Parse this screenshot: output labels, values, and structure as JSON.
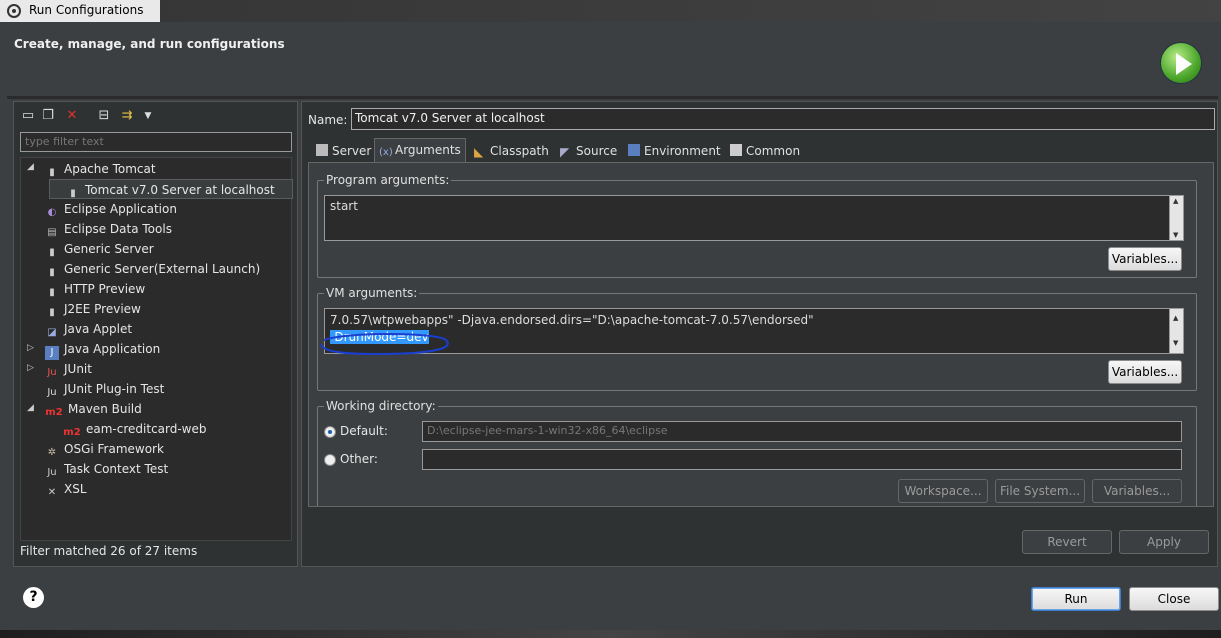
{
  "window": {
    "title": "Run Configurations"
  },
  "header": {
    "title": "Create, manage, and run configurations"
  },
  "left": {
    "filter_placeholder": "type filter text",
    "tree": [
      {
        "label": "Apache Tomcat",
        "icon": "tomcat-icon",
        "expanded": true
      },
      {
        "label": "Tomcat v7.0 Server at localhost",
        "icon": "server-icon",
        "selected": true
      },
      {
        "label": "Eclipse Application",
        "icon": "eclipse-icon"
      },
      {
        "label": "Eclipse Data Tools",
        "icon": "data-tools-icon"
      },
      {
        "label": "Generic Server",
        "icon": "server-icon"
      },
      {
        "label": "Generic Server(External Launch)",
        "icon": "server-icon"
      },
      {
        "label": "HTTP Preview",
        "icon": "server-icon"
      },
      {
        "label": "J2EE Preview",
        "icon": "server-icon"
      },
      {
        "label": "Java Applet",
        "icon": "applet-icon"
      },
      {
        "label": "Java Application",
        "icon": "java-app-icon"
      },
      {
        "label": "JUnit",
        "icon": "junit-icon"
      },
      {
        "label": "JUnit Plug-in Test",
        "icon": "junit-plugin-icon"
      },
      {
        "label": "Maven Build",
        "icon": "m2-icon",
        "expanded": true
      },
      {
        "label": "eam-creditcard-web",
        "icon": "m2-icon"
      },
      {
        "label": "OSGi Framework",
        "icon": "osgi-icon"
      },
      {
        "label": "Task Context Test",
        "icon": "task-icon"
      },
      {
        "label": "XSL",
        "icon": "xsl-icon"
      }
    ],
    "status": "Filter matched 26 of 27 items"
  },
  "right": {
    "name_label": "Name:",
    "name_value": "Tomcat v7.0 Server at localhost",
    "tabs": [
      "Server",
      "Arguments",
      "Classpath",
      "Source",
      "Environment",
      "Common"
    ],
    "active_tab": "Arguments",
    "program_args": {
      "label": "Program arguments:",
      "value": "start",
      "variables": "Variables..."
    },
    "vm_args": {
      "label": "VM arguments:",
      "line1": "7.0.57\\wtpwebapps\" -Djava.endorsed.dirs=\"D:\\apache-tomcat-7.0.57\\endorsed\"",
      "line2": "-DrunMode=dev",
      "variables": "Variables..."
    },
    "working_dir": {
      "label": "Working directory:",
      "default_label": "Default:",
      "default_value": "D:\\eclipse-jee-mars-1-win32-x86_64\\eclipse",
      "other_label": "Other:",
      "workspace": "Workspace...",
      "file_system": "File System...",
      "variables": "Variables..."
    },
    "revert": "Revert",
    "apply": "Apply"
  },
  "footer": {
    "help": "?",
    "run": "Run",
    "close": "Close"
  },
  "colors": {
    "accent": "#3399ff",
    "run_green": "#4aa52a",
    "annotation": "#1a3fcf"
  }
}
